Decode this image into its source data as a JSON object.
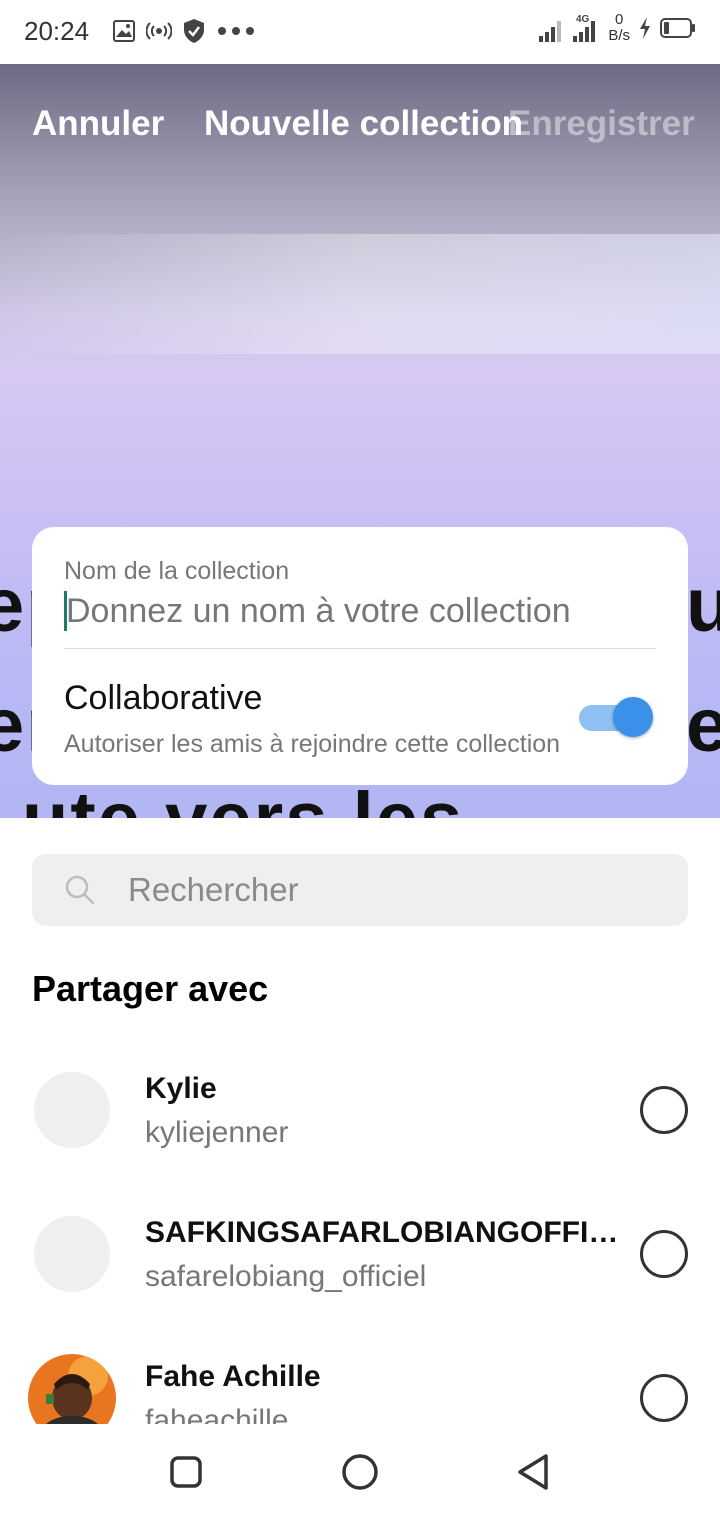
{
  "status_bar": {
    "time": "20:24",
    "speed_value": "0",
    "speed_unit": "B/s",
    "network_type": "4G",
    "icons": [
      "gallery-icon",
      "hotspot-icon",
      "shield-icon",
      "more-dots-icon",
      "signal-icon",
      "signal-4g-icon",
      "charging-icon",
      "battery-icon"
    ]
  },
  "header": {
    "cancel_label": "Annuler",
    "title": "Nouvelle collection",
    "save_label": "Enregistrer"
  },
  "hero_background_text": [
    "ep",
    "us",
    "er",
    "er",
    "ute vers les"
  ],
  "collection_card": {
    "name_label": "Nom de la collection",
    "name_placeholder": "Donnez un nom à votre collection",
    "name_value": "",
    "collaborative_title": "Collaborative",
    "collaborative_subtitle": "Autoriser les amis à rejoindre cette collection",
    "collaborative_enabled": true
  },
  "search": {
    "placeholder": "Rechercher",
    "value": ""
  },
  "share_section": {
    "title": "Partager avec",
    "contacts": [
      {
        "name": "Kylie",
        "username": "kyliejenner",
        "selected": false,
        "avatar": "empty"
      },
      {
        "name": "SAFKINGSAFARLOBIANGOFFICIEL",
        "username": "safarelobiang_officiel",
        "selected": false,
        "avatar": "empty"
      },
      {
        "name": "Fahe Achille",
        "username": "faheachille",
        "selected": false,
        "avatar": "photo"
      }
    ]
  },
  "colors": {
    "toggle_on": "#3b91ea",
    "toggle_track": "#8ec0f2",
    "caret": "#1f7a6e",
    "search_bg": "#efefef"
  },
  "nav_bar": {
    "buttons": [
      "recents-square-icon",
      "home-circle-icon",
      "back-triangle-icon"
    ]
  }
}
